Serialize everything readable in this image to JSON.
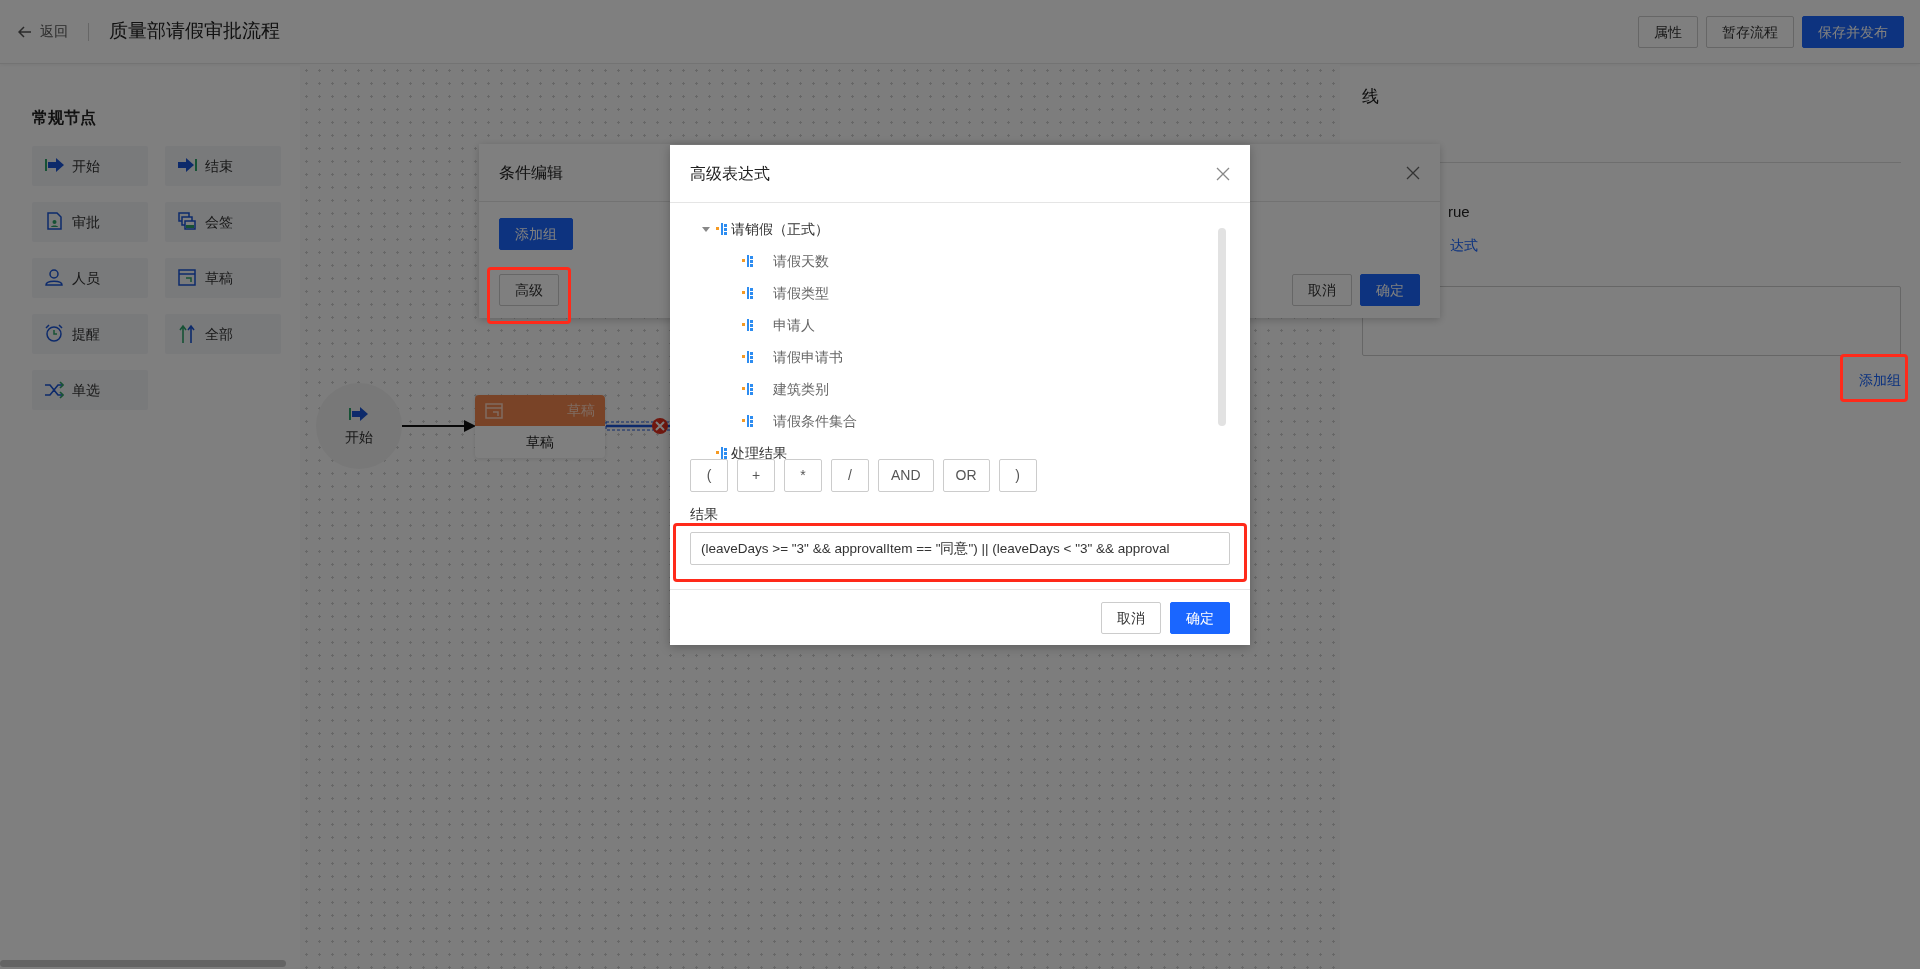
{
  "header": {
    "back_label": "返回",
    "title": "质量部请假审批流程",
    "buttons": [
      {
        "label": "属性",
        "kind": "default"
      },
      {
        "label": "暂存流程",
        "kind": "default"
      },
      {
        "label": "保存并发布",
        "kind": "primary"
      }
    ]
  },
  "sidebar": {
    "heading": "常规节点",
    "nodes": [
      {
        "label": "开始",
        "kind": "start"
      },
      {
        "label": "结束",
        "kind": "end"
      },
      {
        "label": "审批",
        "kind": "approve"
      },
      {
        "label": "会签",
        "kind": "countersign"
      },
      {
        "label": "人员",
        "kind": "person"
      },
      {
        "label": "草稿",
        "kind": "draft"
      },
      {
        "label": "提醒",
        "kind": "remind"
      },
      {
        "label": "全部",
        "kind": "all"
      },
      {
        "label": "单选",
        "kind": "single"
      }
    ]
  },
  "canvas": {
    "start_node": {
      "label": "开始"
    },
    "draft_node": {
      "header": "草稿",
      "label": "草稿"
    }
  },
  "right_panel": {
    "title": "线",
    "value_text": "rue",
    "expression_link": "达式",
    "add_group_link": "添加组"
  },
  "condition_dialog": {
    "title": "条件编辑",
    "add_group": "添加组",
    "advanced": "高级",
    "cancel": "取消",
    "ok": "确定"
  },
  "expression_dialog": {
    "title": "高级表达式",
    "tree": [
      {
        "label": "请销假（正式）",
        "expanded": true,
        "children": [
          {
            "label": "请假天数"
          },
          {
            "label": "请假类型"
          },
          {
            "label": "申请人"
          },
          {
            "label": "请假申请书"
          },
          {
            "label": "建筑类别"
          },
          {
            "label": "请假条件集合"
          }
        ]
      },
      {
        "label": "处理结果"
      }
    ],
    "operators": [
      "(",
      "+",
      "*",
      "/",
      "AND",
      "OR",
      ")"
    ],
    "result_label": "结果",
    "result_value": "(leaveDays >= \"3\" && approvalItem == \"同意\") || (leaveDays < \"3\" && approval",
    "cancel": "取消",
    "ok": "确定"
  }
}
